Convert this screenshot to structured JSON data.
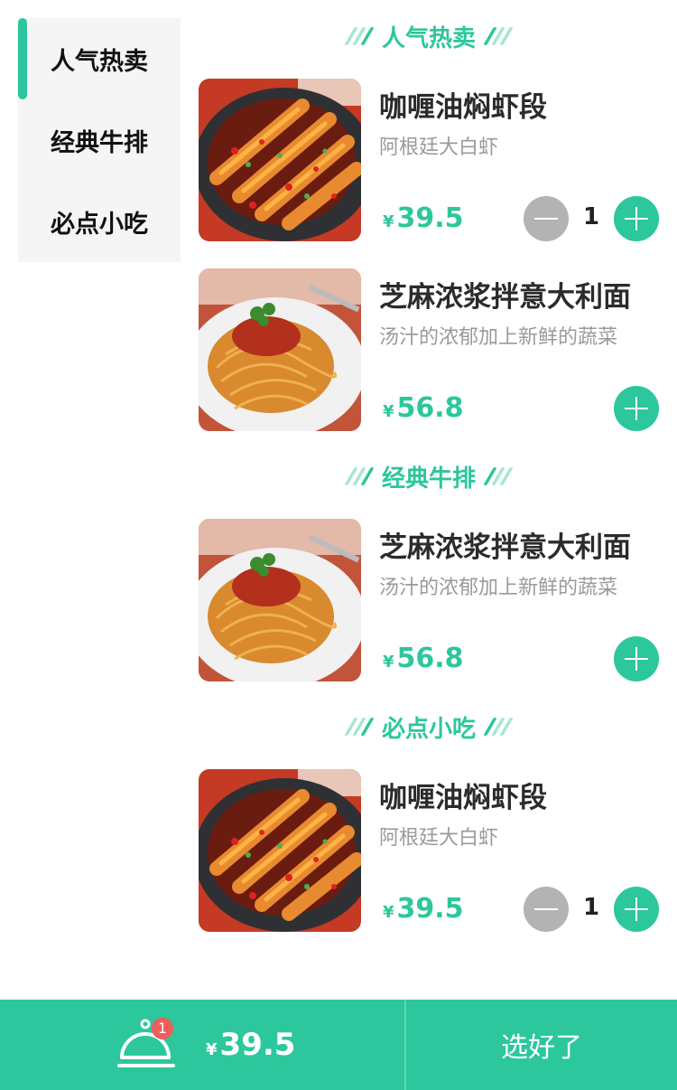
{
  "sidebar": {
    "items": [
      {
        "label": "人气热卖"
      },
      {
        "label": "经典牛排"
      },
      {
        "label": "必点小吃"
      }
    ]
  },
  "sections": [
    {
      "title": "人气热卖",
      "items": [
        {
          "name": "咖喱油焖虾段",
          "desc": "阿根廷大白虾",
          "price": "39.5",
          "qty": "1"
        },
        {
          "name": "芝麻浓浆拌意大利面",
          "desc": "汤汁的浓郁加上新鲜的蔬菜",
          "price": "56.8"
        }
      ]
    },
    {
      "title": "经典牛排",
      "items": [
        {
          "name": "芝麻浓浆拌意大利面",
          "desc": "汤汁的浓郁加上新鲜的蔬菜",
          "price": "56.8"
        }
      ]
    },
    {
      "title": "必点小吃",
      "items": [
        {
          "name": "咖喱油焖虾段",
          "desc": "阿根廷大白虾",
          "price": "39.5",
          "qty": "1"
        }
      ]
    }
  ],
  "currency": "¥",
  "footer": {
    "cart_badge": "1",
    "total": "39.5",
    "confirm_label": "选好了"
  },
  "colors": {
    "accent": "#2cc79c",
    "minus_button": "#b3b3b3",
    "badge": "#f05d5d",
    "sidebar_bg": "#f5f5f5"
  },
  "icons": {
    "cart": "cloche-icon",
    "plus": "plus-icon",
    "minus": "minus-icon"
  }
}
